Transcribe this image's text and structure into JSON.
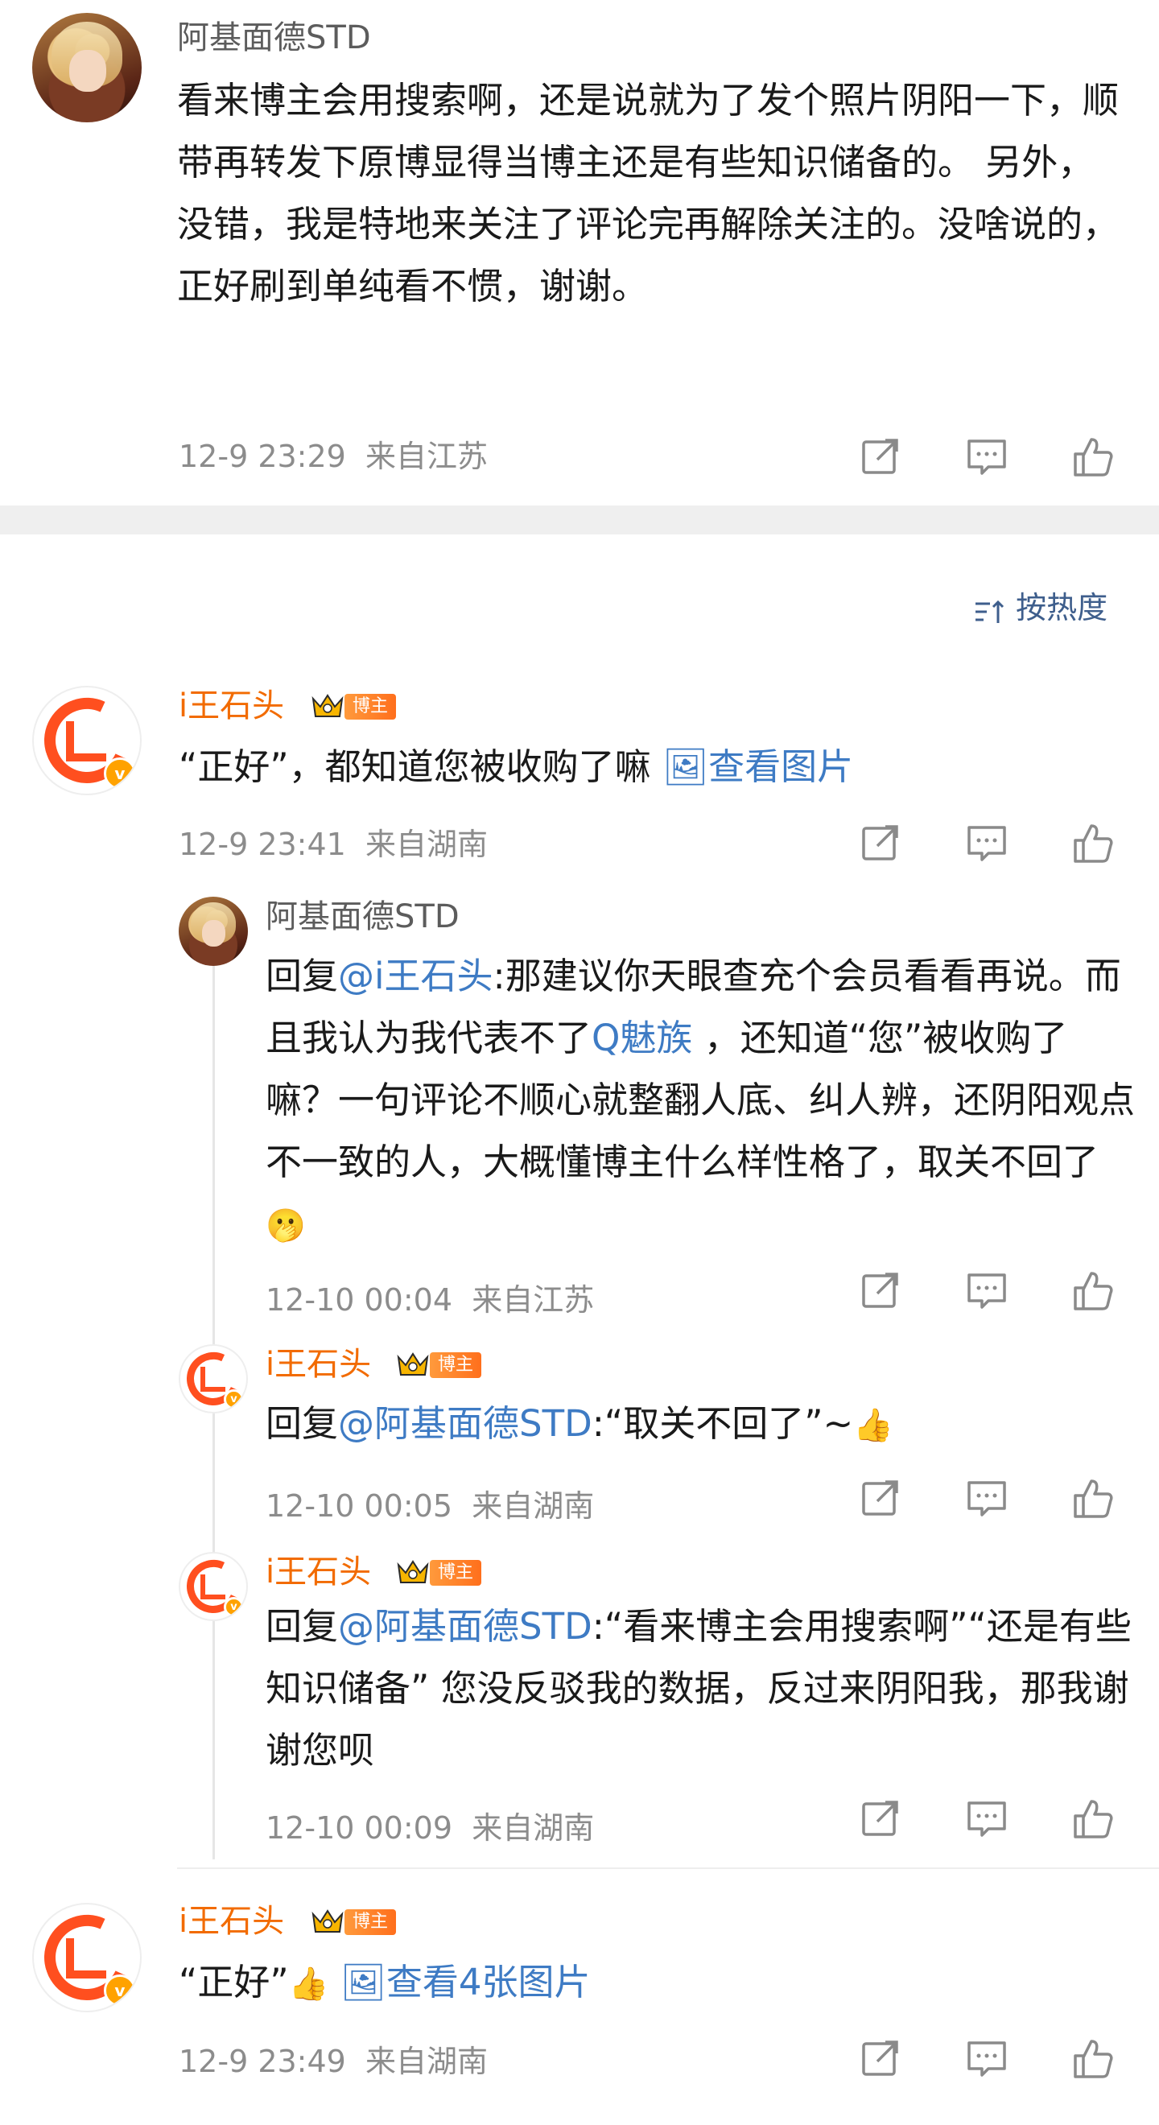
{
  "top_comment": {
    "username": "阿基面德STD",
    "text": "看来博主会用搜索啊，还是说就为了发个照片阴阳一下，顺带再转发下原博显得当博主还是有些知识储备的。 另外，没错，我是特地来关注了评论完再解除关注的。没啥说的，正好刷到单纯看不惯，谢谢。",
    "time": "12-9 23:29",
    "location": "来自江苏"
  },
  "sort": {
    "icon": "sort-icon",
    "label": "按热度"
  },
  "comments": [
    {
      "username": "i王石头",
      "badge": "博主",
      "text": "“正好”，都知道您被收购了嘛 ",
      "image_link": "查看图片",
      "time": "12-9 23:41",
      "location": "来自湖南",
      "replies": [
        {
          "username": "阿基面德STD",
          "prefix": "回复",
          "mention": "@i王石头",
          "text_a": ":那建议你天眼查充个会员看看再说。而且我认为我代表不了",
          "topic": "Q魅族",
          "text_b": " ，还知道“您”被收购了嘛？一句评论不顺心就整翻人底、纠人辨，还阴阳观点不一致的人，大概懂博主什么样性格了，取关不回了",
          "emoji": "🫢",
          "time": "12-10 00:04",
          "location": "来自江苏"
        },
        {
          "username": "i王石头",
          "badge": "博主",
          "prefix": "回复",
          "mention": "@阿基面德STD",
          "text": ":“取关不回了”~",
          "emoji": "👍",
          "time": "12-10 00:05",
          "location": "来自湖南"
        },
        {
          "username": "i王石头",
          "badge": "博主",
          "prefix": "回复",
          "mention": "@阿基面德STD",
          "text": ":“看来博主会用搜索啊”“还是有些知识储备” 您没反驳我的数据，反过来阴阳我，那我谢谢您呗",
          "time": "12-10 00:09",
          "location": "来自湖南"
        }
      ]
    },
    {
      "username": "i王石头",
      "badge": "博主",
      "text": "“正好”",
      "emoji": "👍",
      "image_link": "查看4张图片",
      "time": "12-9 23:49",
      "location": "来自湖南"
    }
  ],
  "action_icons": [
    "share-icon",
    "comment-icon",
    "like-icon"
  ]
}
